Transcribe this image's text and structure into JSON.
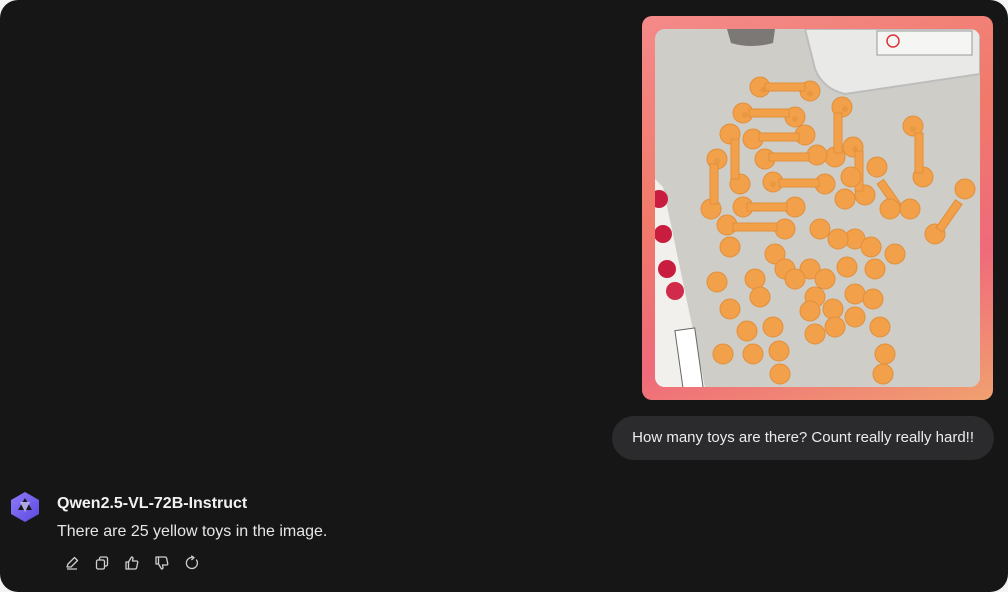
{
  "conversation": {
    "user_message": "How many toys are there? Count really really hard!!",
    "assistant": {
      "model_name": "Qwen2.5-VL-72B-Instruct",
      "reply": "There are 25 yellow toys in the image.",
      "actions": [
        {
          "icon": "edit-icon"
        },
        {
          "icon": "copy-icon"
        },
        {
          "icon": "thumbs-up-icon"
        },
        {
          "icon": "thumbs-down-icon"
        },
        {
          "icon": "regenerate-icon"
        }
      ]
    }
  },
  "colors": {
    "background": "#161617",
    "bubble": "#2b2b2d",
    "toy": "#f3a04a",
    "avatar": "#6f5df0"
  }
}
